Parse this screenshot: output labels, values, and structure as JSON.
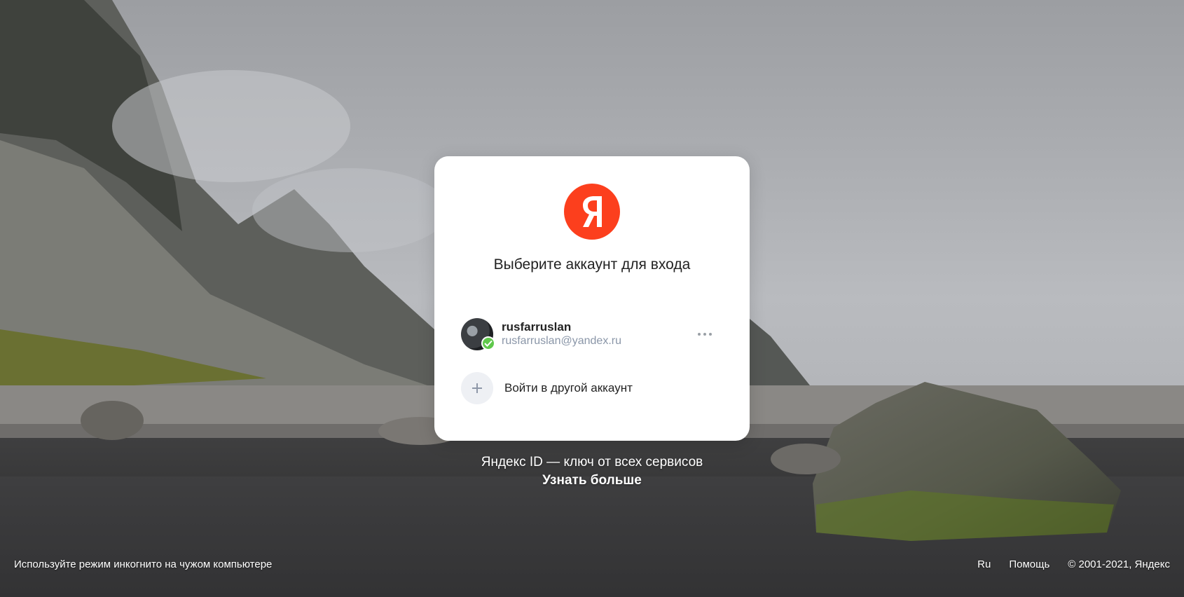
{
  "logo": {
    "letter": "Я",
    "color": "#fc3f1d"
  },
  "card": {
    "title": "Выберите аккаунт для входа",
    "account": {
      "login": "rusfarruslan",
      "email": "rusfarruslan@yandex.ru",
      "badge_color": "#5fc84b"
    },
    "add_account_label": "Войти в другой аккаунт"
  },
  "promo": {
    "text": "Яндекс ID — ключ от всех сервисов",
    "link": "Узнать больше"
  },
  "footer": {
    "incognito_hint": "Используйте режим инкогнито на чужом компьютере",
    "lang": "Ru",
    "help": "Помощь",
    "copyright": "© 2001-2021, Яндекс"
  }
}
